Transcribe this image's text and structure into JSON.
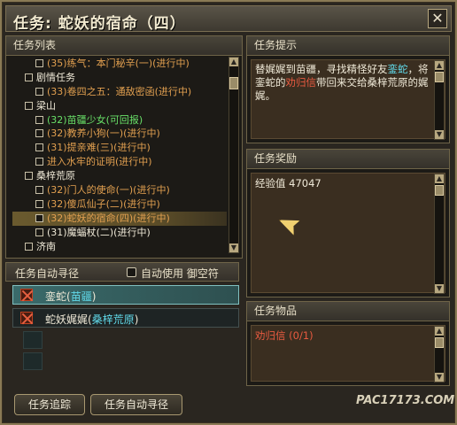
{
  "window": {
    "title": "任务: 蛇妖的宿命（四）",
    "close_symbol": "✕"
  },
  "quest_list": {
    "header": "任务列表",
    "rows": [
      {
        "type": "item",
        "text": "(35)练气：本门秘辛(一)(进行中)",
        "status": "in-progress"
      },
      {
        "type": "cat",
        "text": "剧情任务"
      },
      {
        "type": "item",
        "text": "(33)卷四之五：通敌密函(进行中)",
        "status": "in-progress"
      },
      {
        "type": "cat",
        "text": "梁山"
      },
      {
        "type": "item",
        "text": "(32)苗疆少女(可回报)",
        "status": "done"
      },
      {
        "type": "item",
        "text": "(32)教养小狗(一)(进行中)",
        "status": "in-progress"
      },
      {
        "type": "item",
        "text": "(31)提亲难(三)(进行中)",
        "status": "in-progress"
      },
      {
        "type": "item",
        "text": "进入水牢的证明(进行中)",
        "status": "in-progress"
      },
      {
        "type": "cat",
        "text": "桑梓荒原"
      },
      {
        "type": "item",
        "text": "(32)门人的使命(一)(进行中)",
        "status": "in-progress"
      },
      {
        "type": "item",
        "text": "(32)傻瓜仙子(二)(进行中)",
        "status": "in-progress"
      },
      {
        "type": "item",
        "text": "(32)蛇妖的宿命(四)(进行中)",
        "status": "selected"
      },
      {
        "type": "item",
        "text": "(31)魔蝠杖(二)(进行中)",
        "status": "white"
      },
      {
        "type": "cat",
        "text": "济南"
      }
    ]
  },
  "auto_path": {
    "header": "任务自动寻径",
    "auto_use_label": "自动使用 御空符",
    "targets": [
      {
        "name": "銮蛇",
        "location": "苗疆",
        "active": true
      },
      {
        "name": "蛇妖娓娓",
        "location": "桑梓荒原",
        "active": false
      }
    ]
  },
  "buttons": {
    "track": "任务追踪",
    "auto_path": "任务自动寻径"
  },
  "hint": {
    "header": "任务提示",
    "text_parts": [
      {
        "text": "替娓娓到苗疆，寻找精怪好友",
        "style": "normal"
      },
      {
        "text": "銮蛇",
        "style": "cyan"
      },
      {
        "text": "，将銮蛇的",
        "style": "normal"
      },
      {
        "text": "劝归信",
        "style": "red"
      },
      {
        "text": "带回来交给桑梓荒原的娓娓。",
        "style": "normal"
      }
    ]
  },
  "reward": {
    "header": "任务奖励",
    "text": "经验值 47047"
  },
  "items": {
    "header": "任务物品",
    "text": "劝归信 (0/1)"
  },
  "watermark": {
    "text": "PAC17173.COM"
  },
  "colors": {
    "in_progress": "#e2a050",
    "done": "#68e068",
    "highlight_cyan": "#60d8e8",
    "highlight_red": "#e85a40",
    "frame_gold": "#8a7a55"
  }
}
